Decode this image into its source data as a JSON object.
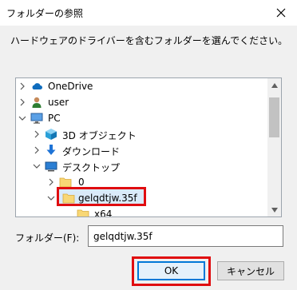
{
  "window": {
    "title": "フォルダーの参照",
    "close_icon": "close-icon"
  },
  "instruction": "ハードウェアのドライバーを含むフォルダーを選んでください。",
  "tree": {
    "items": [
      {
        "label": "OneDrive",
        "icon": "cloud-icon",
        "chevron": "chevron-right-icon"
      },
      {
        "label": "user",
        "icon": "user-icon",
        "chevron": "chevron-right-icon"
      },
      {
        "label": "PC",
        "icon": "pc-icon",
        "chevron": "chevron-down-icon"
      },
      {
        "label": "3D オブジェクト",
        "icon": "3d-objects-icon",
        "chevron": "chevron-right-icon"
      },
      {
        "label": "ダウンロード",
        "icon": "download-icon",
        "chevron": "chevron-right-icon"
      },
      {
        "label": "デスクトップ",
        "icon": "desktop-icon",
        "chevron": "chevron-down-icon"
      },
      {
        "label": "0",
        "icon": "folder-icon",
        "chevron": "chevron-right-icon"
      },
      {
        "label": "gelqdtjw.35f",
        "icon": "folder-icon",
        "chevron": "chevron-down-icon",
        "selected": true
      },
      {
        "label": "x64",
        "icon": "folder-icon",
        "chevron": ""
      }
    ]
  },
  "folder_field": {
    "label": "フォルダー(F):",
    "value": "gelqdtjw.35f"
  },
  "buttons": {
    "ok": "OK",
    "cancel": "キャンセル"
  },
  "colors": {
    "highlight_red": "#e00d10",
    "accent_blue": "#0078d7",
    "folder_yellow": "#f8d775"
  }
}
